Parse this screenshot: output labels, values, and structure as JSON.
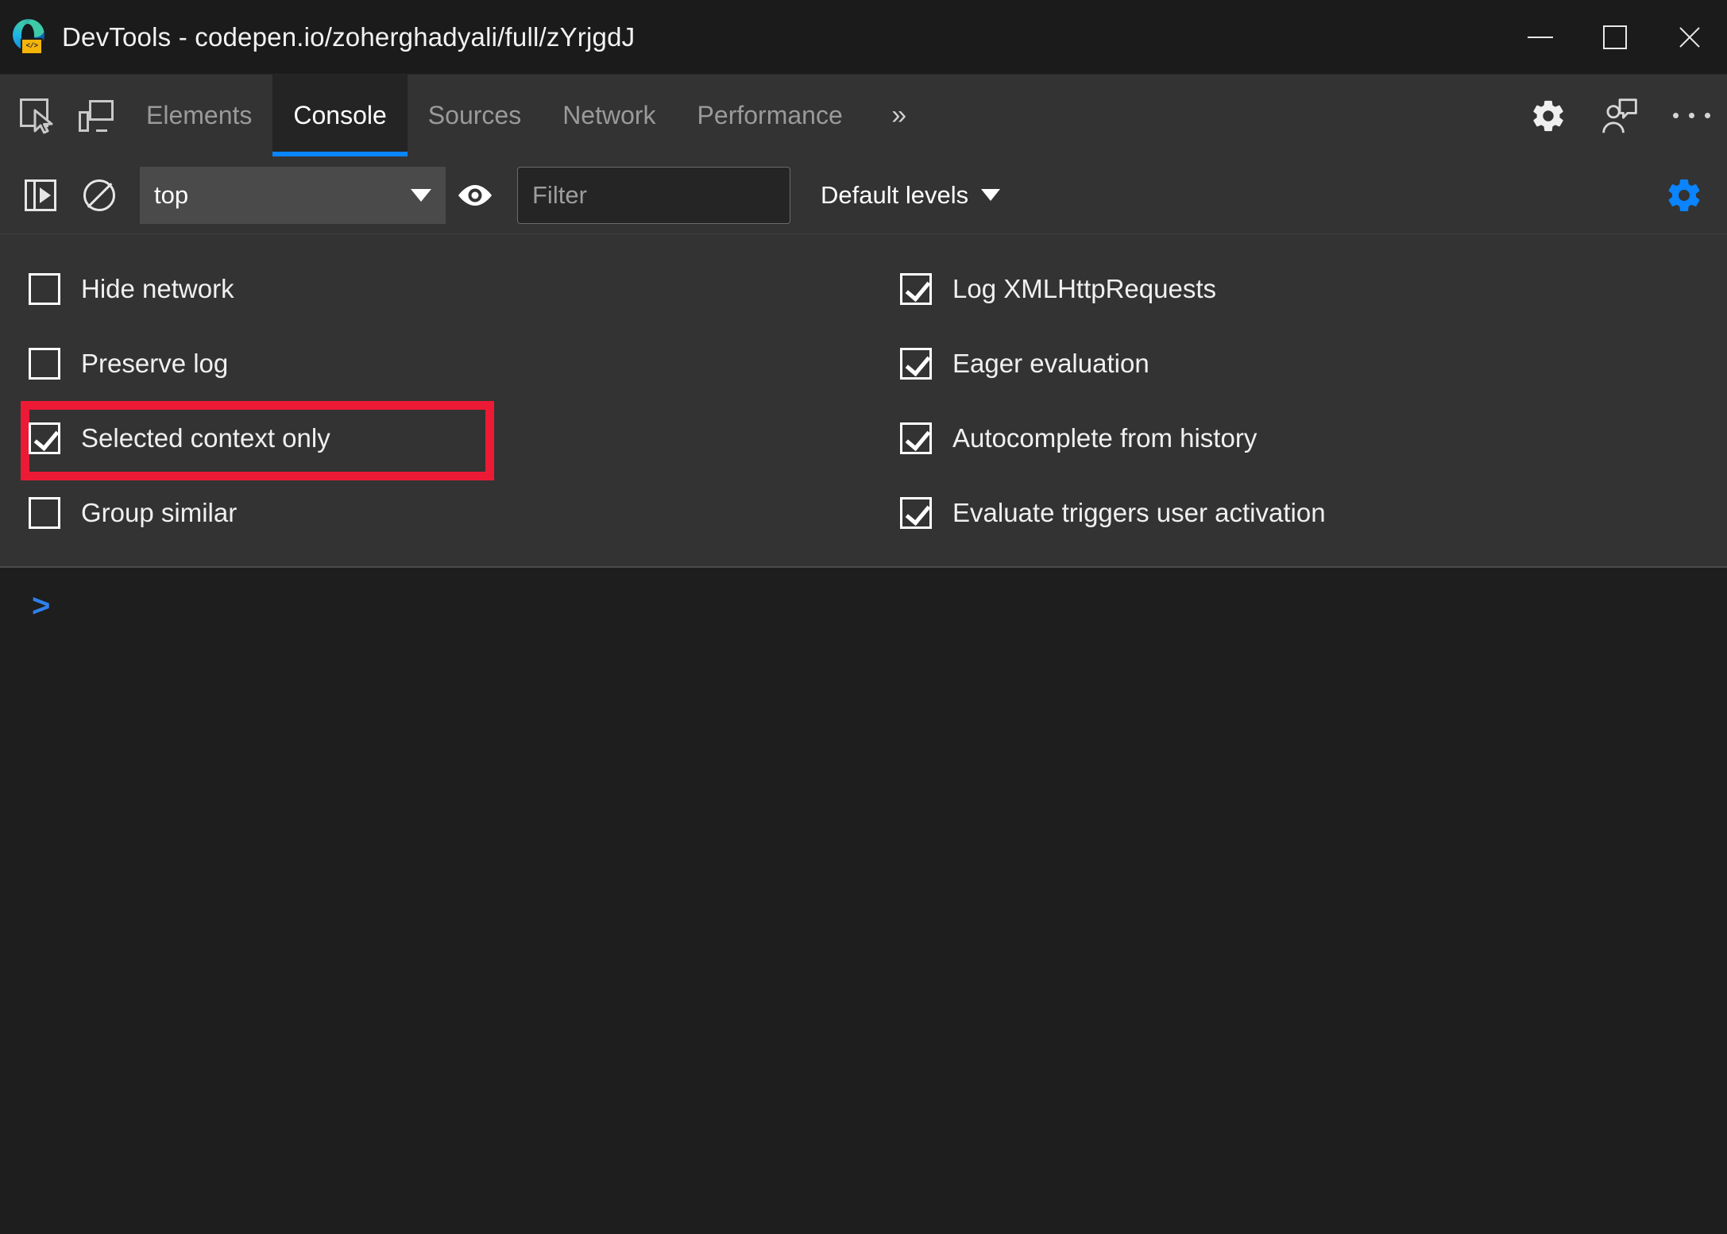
{
  "window": {
    "title": "DevTools - codepen.io/zoherghadyali/full/zYrjgdJ",
    "app_icon": "edge-devtools-icon",
    "badge_text": "</>",
    "controls": {
      "minimize": "minimize-icon",
      "maximize": "maximize-icon",
      "close": "close-icon"
    }
  },
  "tabbar": {
    "inspect_icon": "inspect-element-icon",
    "device_icon": "device-toolbar-icon",
    "tabs": [
      {
        "label": "Elements",
        "active": false
      },
      {
        "label": "Console",
        "active": true
      },
      {
        "label": "Sources",
        "active": false
      },
      {
        "label": "Network",
        "active": false
      },
      {
        "label": "Performance",
        "active": false
      }
    ],
    "more_tabs": "»",
    "right_icons": {
      "settings": "gear-icon",
      "feedback": "feedback-person-icon",
      "more_options": "more-options-icon"
    },
    "active_underline_color": "#0a84ff"
  },
  "console_toolbar": {
    "sidebar_toggle_icon": "console-sidebar-toggle-icon",
    "clear_icon": "clear-console-icon",
    "context": {
      "value": "top",
      "caret": "chevron-down-icon"
    },
    "eye_icon": "create-live-expression-icon",
    "filter": {
      "value": "",
      "placeholder": "Filter"
    },
    "log_levels": {
      "label": "Default levels",
      "caret": "chevron-down-icon"
    },
    "settings_gear": {
      "icon": "console-settings-gear-icon",
      "color": "#0a84ff",
      "active": true
    }
  },
  "settings_panel": {
    "left_column": [
      {
        "label": "Hide network",
        "checked": false,
        "highlighted": false
      },
      {
        "label": "Preserve log",
        "checked": false,
        "highlighted": false
      },
      {
        "label": "Selected context only",
        "checked": true,
        "highlighted": true
      },
      {
        "label": "Group similar",
        "checked": false,
        "highlighted": false
      }
    ],
    "right_column": [
      {
        "label": "Log XMLHttpRequests",
        "checked": true,
        "highlighted": false
      },
      {
        "label": "Eager evaluation",
        "checked": true,
        "highlighted": false
      },
      {
        "label": "Autocomplete from history",
        "checked": true,
        "highlighted": false
      },
      {
        "label": "Evaluate triggers user activation",
        "checked": true,
        "highlighted": false
      }
    ],
    "highlight_color": "#ed1a36"
  },
  "console": {
    "prompt_symbol": ">",
    "input_value": "",
    "prompt_color": "#2f80ed"
  }
}
